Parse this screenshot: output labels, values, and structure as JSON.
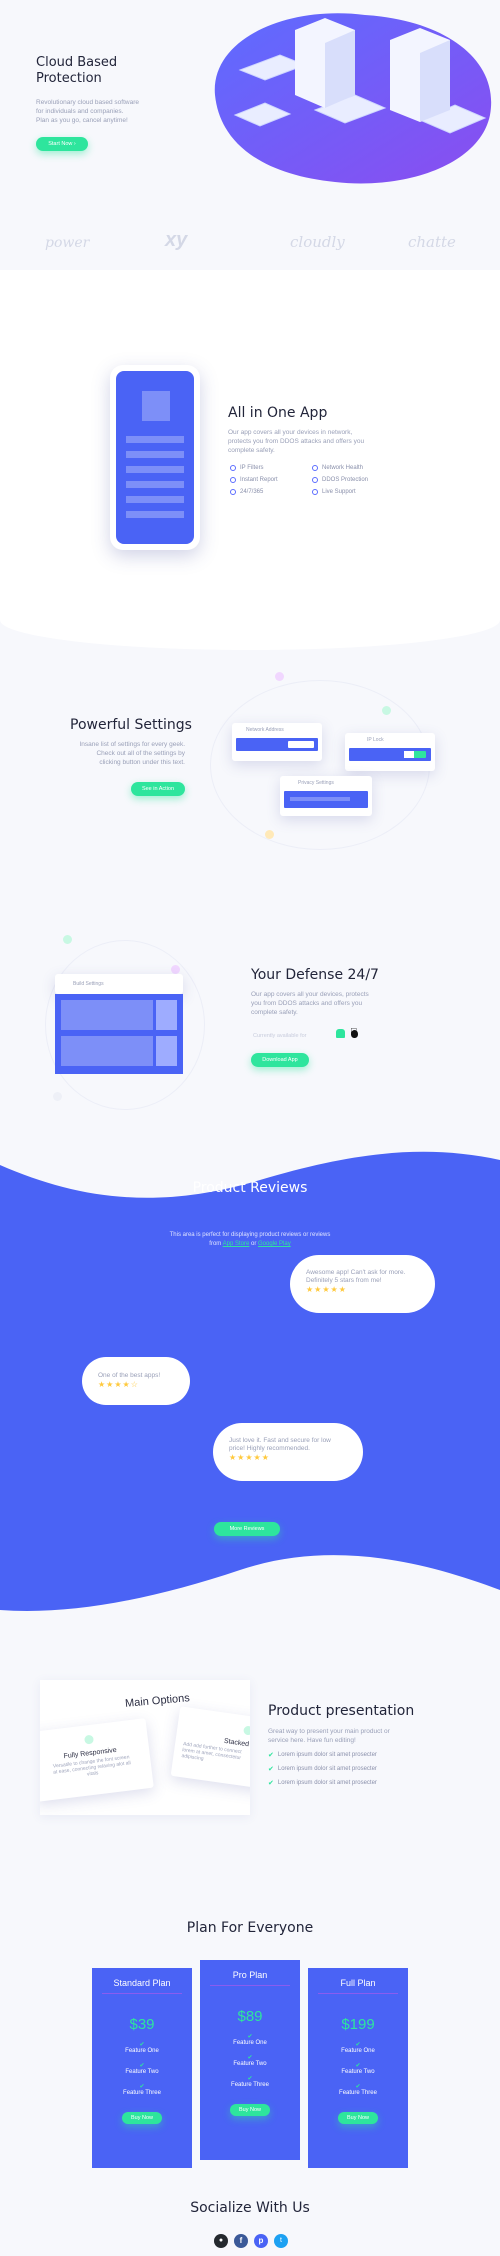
{
  "hero": {
    "title_line1": "Cloud Based",
    "title_line2": "Protection",
    "desc_line1": "Revolutionary cloud based software",
    "desc_line2": "for individuals and companies.",
    "desc_line3": "Plan as you go, cancel anytime!",
    "cta": "Start Now",
    "cta_icon": "arrow-right-icon"
  },
  "logos": [
    "power",
    "xy",
    "cloudly",
    "chatte"
  ],
  "all_in_one": {
    "title": "All in One App",
    "desc_line1": "Our app covers all your devices in network,",
    "desc_line2": "protects you from DDOS attacks and offers you",
    "desc_line3": "complete safety.",
    "features": [
      "IP Filters",
      "Network Health",
      "Instant Report",
      "DDOS Protection",
      "24/7/365",
      "Live Support"
    ]
  },
  "settings": {
    "title": "Powerful Settings",
    "desc_line1": "Insane list of settings for every geek.",
    "desc_line2": "Check out all of the settings by",
    "desc_line3": "clicking button under this text.",
    "cta": "See in Action",
    "card1": "Network Address",
    "card2": "IP Lock",
    "card3": "Privacy Settings"
  },
  "defense": {
    "title": "Your Defense 24/7",
    "desc_line1": "Our app covers all your devices, protects",
    "desc_line2": "you from DDOS attacks and offers you",
    "desc_line3": "complete safety.",
    "note": "Currently available for",
    "cta": "Download App",
    "panel_label": "Build Settings"
  },
  "reviews": {
    "title": "Product Reviews",
    "sub_line1": "This area is perfect for displaying  product reviews or reviews",
    "sub_from": "from",
    "link1": "App Store",
    "or": "or",
    "link2": "Google Play",
    "items": [
      {
        "text_line1": "Awesome app! Can't ask for more.",
        "text_line2": "Definitely 5 stars from me!",
        "stars": "★★★★★",
        "rating": 5
      },
      {
        "text_line1": "One of the best apps!",
        "text_line2": "",
        "stars": "★★★★☆",
        "rating": 4
      },
      {
        "text_line1": "Just love it. Fast and secure for low",
        "text_line2": "price! Highly recommended.",
        "stars": "★★★★★",
        "rating": 5
      }
    ],
    "cta": "More Reviews"
  },
  "presentation": {
    "title": "Product presentation",
    "desc_line1": "Great way to present your main product or",
    "desc_line2": "service here. Have fun editing!",
    "bullets": [
      "Lorem ipsum dolor sit amet prosecter",
      "Lorem ipsum dolor sit amet prosecter",
      "Lorem ipsum dolor sit amet prosecter"
    ],
    "card_title": "Main Options",
    "opt1": "Fully Responsive",
    "opt1_line1": "Versatile to change the font screen",
    "opt1_line2": "at ease, connecting relaxing alot all",
    "opt1_line3": "vitals",
    "opt2": "Stacked V",
    "opt2_line1": "Add add further to connect",
    "opt2_line2": "lorem at amet, consectetur",
    "opt2_line3": "adipiscing"
  },
  "pricing": {
    "title": "Plan For Everyone",
    "plans": [
      {
        "name": "Standard Plan",
        "price": "$39",
        "features": [
          "Feature One",
          "Feature Two",
          "Feature Three"
        ],
        "cta": "Buy Now"
      },
      {
        "name": "Pro Plan",
        "price": "$89",
        "features": [
          "Feature One",
          "Feature Two",
          "Feature Three"
        ],
        "cta": "Buy Now"
      },
      {
        "name": "Full Plan",
        "price": "$199",
        "features": [
          "Feature One",
          "Feature Two",
          "Feature Three"
        ],
        "cta": "Buy Now"
      }
    ]
  },
  "social": {
    "title": "Socialize With Us",
    "icons": [
      "github-icon",
      "facebook-icon",
      "pinterest-icon",
      "twitter-icon"
    ]
  },
  "colors": {
    "primary": "#4a63f5",
    "accent": "#2ee59d",
    "background": "#f7f8fc"
  }
}
